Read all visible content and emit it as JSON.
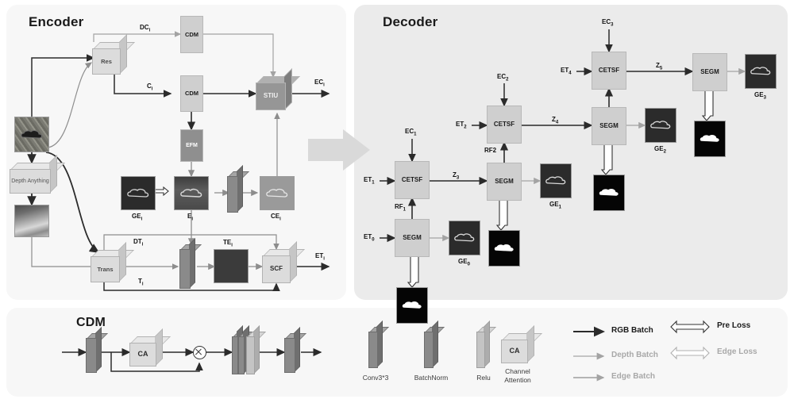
{
  "panels": {
    "encoder": {
      "title": "Encoder"
    },
    "decoder": {
      "title": "Decoder"
    },
    "cdm": {
      "title": "CDM"
    }
  },
  "encoder": {
    "blocks": {
      "res": "Res",
      "trans": "Trans",
      "depth_anything": "Depth Anything",
      "cdm_top": "CDM",
      "cdm_bottom": "CDM",
      "efm": "EFM",
      "stiu": "STIU",
      "scf": "SCF"
    },
    "signals": {
      "dc": "DC",
      "dc_sub": "i",
      "c": "C",
      "c_sub": "i",
      "ec": "EC",
      "ec_sub": "i",
      "dt": "DT",
      "dt_sub": "i",
      "t": "T",
      "t_sub": "i",
      "et": "ET",
      "et_sub": "i",
      "ge": "GE",
      "ge_sub": "i",
      "e": "E",
      "e_sub": "i",
      "ce": "CE",
      "ce_sub": "i",
      "te": "TE",
      "te_sub": "i"
    }
  },
  "decoder": {
    "blocks": {
      "cetsf": "CETSF",
      "segm": "SEGM"
    },
    "inputs": [
      {
        "label": "ET",
        "sub": "0"
      },
      {
        "label": "ET",
        "sub": "1"
      },
      {
        "label": "ET",
        "sub": "2"
      },
      {
        "label": "ET",
        "sub": "4"
      }
    ],
    "skips": [
      {
        "label": "EC",
        "sub": "1"
      },
      {
        "label": "EC",
        "sub": "2"
      },
      {
        "label": "EC",
        "sub": "3"
      }
    ],
    "refine": [
      {
        "label": "RF",
        "sub": "1"
      },
      {
        "label": "RF2",
        "sub": ""
      }
    ],
    "latents": [
      {
        "label": "Z",
        "sub": "3"
      },
      {
        "label": "Z",
        "sub": "4"
      },
      {
        "label": "Z",
        "sub": "5"
      }
    ],
    "outputs": [
      {
        "label": "GE",
        "sub": "0"
      },
      {
        "label": "GE",
        "sub": "1"
      },
      {
        "label": "GE",
        "sub": "2"
      },
      {
        "label": "GE",
        "sub": "3"
      }
    ]
  },
  "cdm_detail": {
    "ca_block": "CA"
  },
  "parts_legend": [
    {
      "name": "Conv3*3",
      "kind": "slab-dark"
    },
    {
      "name": "BatchNorm",
      "kind": "slab-dark"
    },
    {
      "name": "Relu",
      "kind": "slab-light"
    },
    {
      "name": "CA",
      "caption": "Channel Attention",
      "kind": "cube"
    }
  ],
  "arrow_legend": {
    "left": [
      {
        "text": "RGB Batch",
        "color": "#1a1a1a"
      },
      {
        "text": "Depth Batch",
        "color": "#a8a8a8"
      },
      {
        "text": "Edge Batch",
        "color": "#a8a8a8"
      }
    ],
    "right": [
      {
        "text": "Pre Loss",
        "color": "#1a1a1a"
      },
      {
        "text": "Edge Loss",
        "color": "#a8a8a8"
      }
    ]
  },
  "colors": {
    "rgb_batch": "#2b2b2b",
    "depth_batch": "#a8a8a8",
    "edge_batch": "#9e9e9e",
    "encoder_bg": "#f7f7f7",
    "decoder_bg": "#ebebeb",
    "block_light": "#cfcfcf",
    "block_dark": "#8f8f8f"
  }
}
